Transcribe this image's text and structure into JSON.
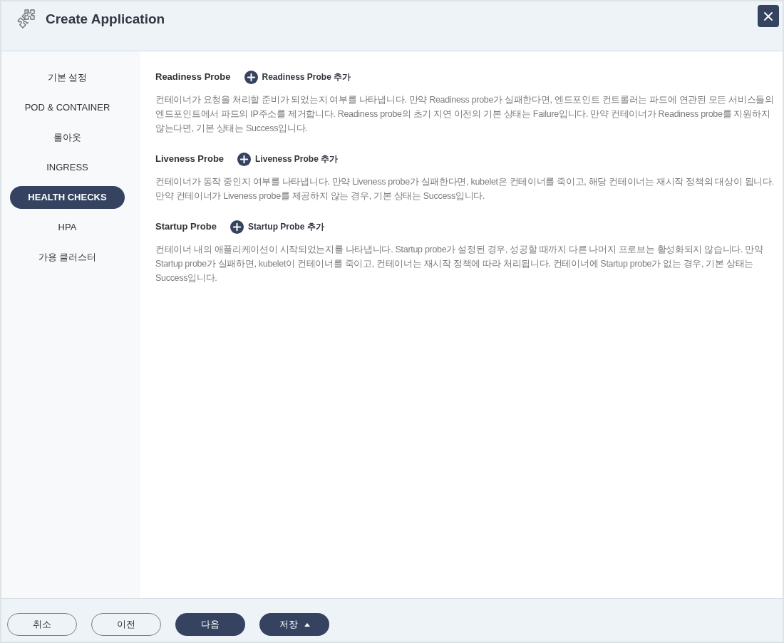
{
  "window": {
    "title": "Create Application"
  },
  "sidebar": {
    "items": [
      {
        "label": "기본 설정",
        "selected": false
      },
      {
        "label": "POD & CONTAINER",
        "selected": false
      },
      {
        "label": "롤아웃",
        "selected": false
      },
      {
        "label": "INGRESS",
        "selected": false
      },
      {
        "label": "HEALTH CHECKS",
        "selected": true
      },
      {
        "label": "HPA",
        "selected": false
      },
      {
        "label": "가용 클러스터",
        "selected": false
      }
    ]
  },
  "sections": [
    {
      "title": "Readiness Probe",
      "add_button": "Readiness Probe 추가",
      "description": "컨테이너가 요청을 처리할 준비가 되었는지 여부를 나타냅니다. 만약 Readiness probe가 실패한다면, 엔드포인트 컨트롤러는 파드에 연관된 모든 서비스들의 엔드포인트에서 파드의 IP주소를 제거합니다. Readiness probe의 초기 지연 이전의 기본 상태는 Failure입니다. 만약 컨테이너가 Readiness probe를 지원하지 않는다면, 기본 상태는 Success입니다."
    },
    {
      "title": "Liveness Probe",
      "add_button": "Liveness Probe 추가",
      "description": "컨테이너가 동작 중인지 여부를 나타냅니다. 만약 Liveness probe가 실패한다면, kubelet은 컨테이너를 죽이고, 해당 컨테이너는 재시작 정책의 대상이 됩니다. 만약 컨테이너가 Liveness probe를 제공하지 않는 경우, 기본 상태는 Success입니다."
    },
    {
      "title": "Startup Probe",
      "add_button": "Startup Probe 추가",
      "description": "컨테이너 내의 애플리케이션이 시작되었는지를 나타냅니다. Startup probe가 설정된 경우, 성공할 때까지 다른 나머지 프로브는 활성화되지 않습니다. 만약 Startup probe가 실패하면, kubelet이 컨테이너를 죽이고, 컨테이너는 재시작 정책에 따라 처리됩니다. 컨테이너에 Startup probe가 없는 경우, 기본 상태는 Success입니다."
    }
  ],
  "footer": {
    "buttons": [
      {
        "label": "취소",
        "kind": "outline"
      },
      {
        "label": "이전",
        "kind": "outline"
      },
      {
        "label": "다음",
        "kind": "primary"
      },
      {
        "label": "저장",
        "kind": "dropdown"
      }
    ]
  }
}
